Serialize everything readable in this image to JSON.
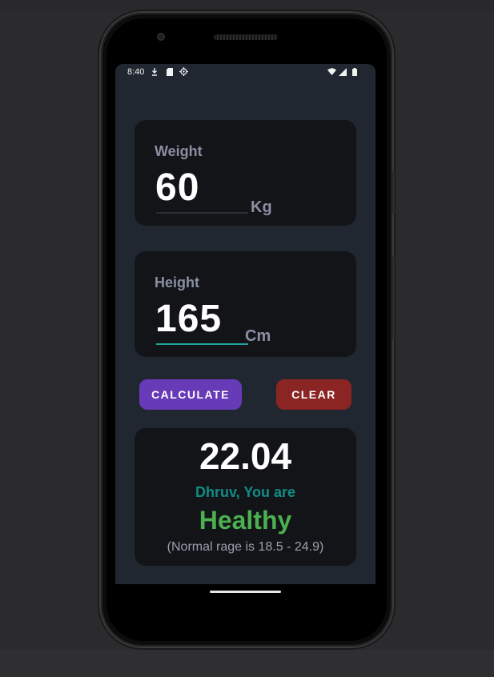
{
  "status_bar": {
    "time": "8:40",
    "left_icons": [
      "download-icon",
      "sd-card-icon",
      "gps-icon"
    ],
    "right_icons": [
      "wifi-icon",
      "signal-icon",
      "battery-icon"
    ]
  },
  "weight": {
    "label": "Weight",
    "value": "60",
    "unit": "Kg"
  },
  "height": {
    "label": "Height",
    "value": "165",
    "unit": "Cm"
  },
  "buttons": {
    "calculate": "CALCULATE",
    "clear": "CLEAR"
  },
  "result": {
    "bmi": "22.04",
    "message": "Dhruv, You are",
    "status": "Healthy",
    "range_note": "(Normal rage is 18.5 - 24.9)"
  },
  "colors": {
    "screen_bg": "#212731",
    "card_bg": "#121418",
    "calculate_button": "#673ab7",
    "clear_button": "#8b2523",
    "accent_teal": "#118c86",
    "healthy_green": "#4caf50",
    "label_gray": "#8a8fa3"
  }
}
